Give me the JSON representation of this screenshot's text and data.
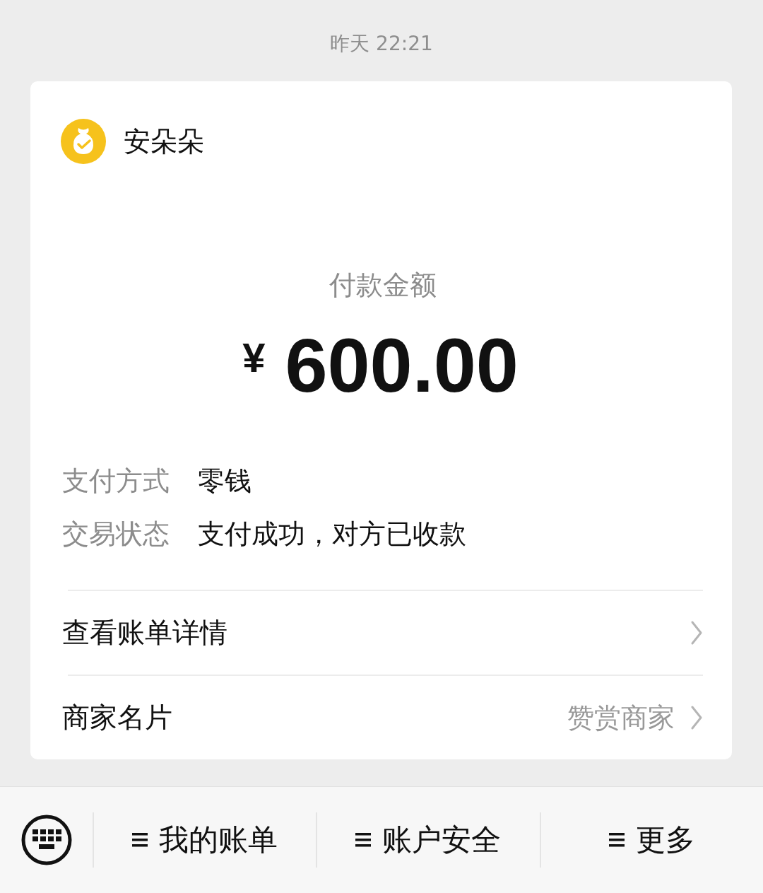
{
  "timestamp": "昨天 22:21",
  "card": {
    "merchant": {
      "name": "安朵朵"
    },
    "amount_label": "付款金额",
    "currency": "¥",
    "amount": "600.00",
    "details": [
      {
        "label": "支付方式",
        "value": "零钱"
      },
      {
        "label": "交易状态",
        "value": "支付成功，对方已收款"
      }
    ],
    "links": [
      {
        "label": "查看账单详情"
      },
      {
        "label": "商家名片",
        "action": "赞赏商家"
      }
    ]
  },
  "bottom_bar": {
    "menus": [
      {
        "label": "我的账单"
      },
      {
        "label": "账户安全"
      },
      {
        "label": "更多"
      }
    ]
  }
}
